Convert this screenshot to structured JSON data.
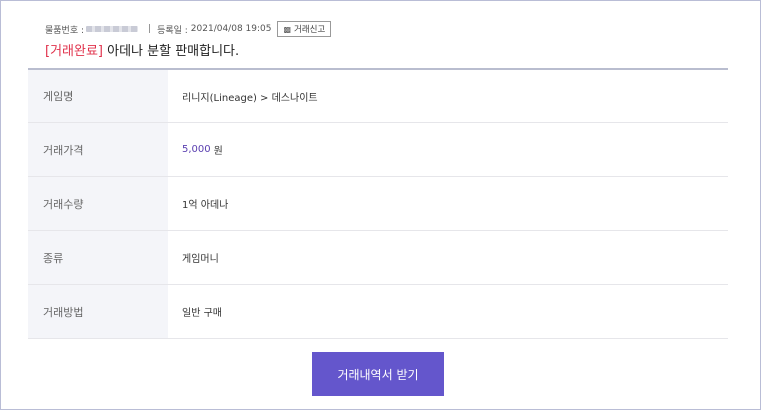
{
  "meta": {
    "item_no_label": "물품번호 :",
    "separator": "|",
    "reg_date_label": "등록일 :",
    "reg_date_value": "2021/04/08 19:05",
    "report_label": "거래신고"
  },
  "title": {
    "status": "[거래완료]",
    "text": "아데나 분할 판매합니다."
  },
  "details": [
    {
      "label": "게임명",
      "value": "리니지(Lineage) > 데스나이트"
    },
    {
      "label": "거래가격",
      "value": "5,000",
      "unit": "원"
    },
    {
      "label": "거래수량",
      "value": "1억 아데나"
    },
    {
      "label": "종류",
      "value": "게임머니"
    },
    {
      "label": "거래방법",
      "value": "일반 구매"
    }
  ],
  "receipt_button": "거래내역서 받기",
  "colors": {
    "status": "#e0314b",
    "price": "#5a3fb0",
    "button": "#6456cc",
    "label_bg": "#f4f5f9"
  }
}
